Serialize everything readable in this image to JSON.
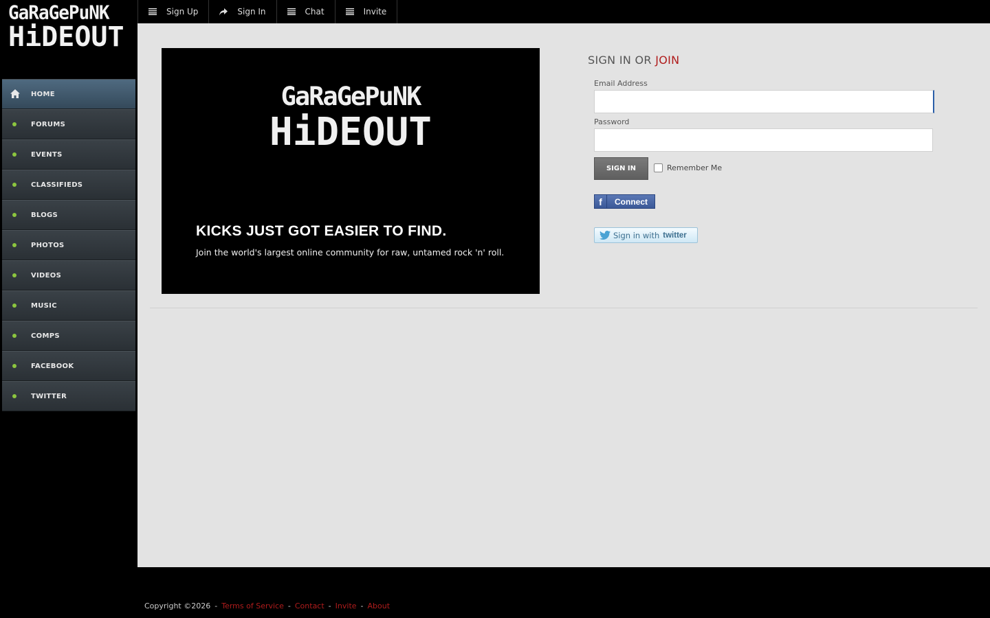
{
  "brand": {
    "logo_line1": "GaRaGePuNK",
    "logo_line2": "HiDEOUT"
  },
  "topnav": {
    "items": [
      {
        "label": "Sign Up",
        "icon": "list-icon"
      },
      {
        "label": "Sign In",
        "icon": "share-arrow-icon"
      },
      {
        "label": "Chat",
        "icon": "list-icon"
      },
      {
        "label": "Invite",
        "icon": "list-icon"
      }
    ]
  },
  "sidebar": {
    "items": [
      {
        "label": "HOME",
        "icon": "home-icon",
        "active": true
      },
      {
        "label": "FORUMS"
      },
      {
        "label": "EVENTS"
      },
      {
        "label": "CLASSIFIEDS"
      },
      {
        "label": "BLOGS"
      },
      {
        "label": "PHOTOS"
      },
      {
        "label": "VIDEOS"
      },
      {
        "label": "MUSIC"
      },
      {
        "label": "COMPS"
      },
      {
        "label": "FACEBOOK"
      },
      {
        "label": "TWITTER"
      }
    ]
  },
  "hero": {
    "logo_line1": "GaRaGePuNK",
    "logo_line2": "HiDEOUT",
    "headline": "KICKS JUST GOT EASIER TO FIND.",
    "subtext": "Join the world's largest online community for raw, untamed rock 'n' roll."
  },
  "signin": {
    "title_prefix": "SIGN IN OR ",
    "title_join": "JOIN",
    "email_label": "Email Address",
    "email_value": "",
    "password_label": "Password",
    "password_value": "",
    "button_label": "SIGN IN",
    "remember_label": "Remember Me",
    "facebook_label": "Connect",
    "twitter_label_prefix": "Sign in with",
    "twitter_label_brand": "twitter"
  },
  "footer": {
    "copyright": "Copyright ©2026",
    "links": [
      "Terms of Service",
      "Contact",
      "Invite",
      "About"
    ]
  },
  "colors": {
    "accent_red": "#b01c1c",
    "status_green": "#8cc63f",
    "facebook_blue": "#3b5998"
  }
}
